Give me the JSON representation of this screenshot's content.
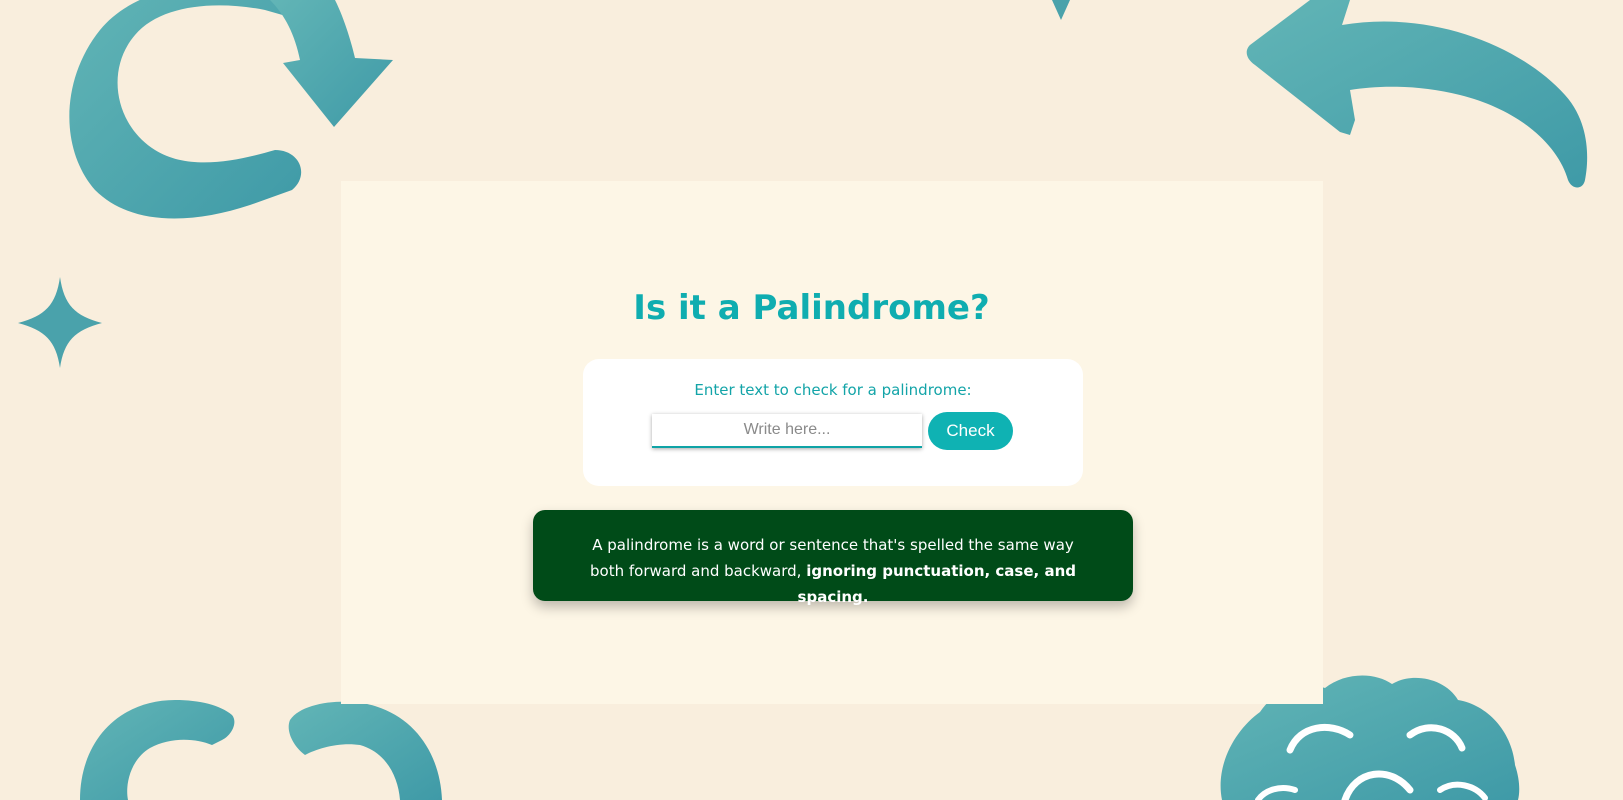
{
  "page": {
    "title": "Is it a Palindrome?"
  },
  "form": {
    "label": "Enter text to check for a palindrome:",
    "input_value": "",
    "input_placeholder": "Write here...",
    "check_label": "Check"
  },
  "info": {
    "text": "A palindrome is a word or sentence that's spelled the same way both forward and backward,",
    "emphasis": "ignoring punctuation, case, and spacing."
  },
  "colors": {
    "background": "#f9eedd",
    "card": "#fdf6e6",
    "accent": "#0fb2b3",
    "title": "#0fadb0",
    "info_background": "#004b18",
    "decor": "#4aa7ad"
  },
  "decorations": [
    "refresh-arrow-icon",
    "sparkle-icon",
    "curved-back-arrow-icon",
    "cycle-arrows-icon",
    "brain-icon"
  ]
}
